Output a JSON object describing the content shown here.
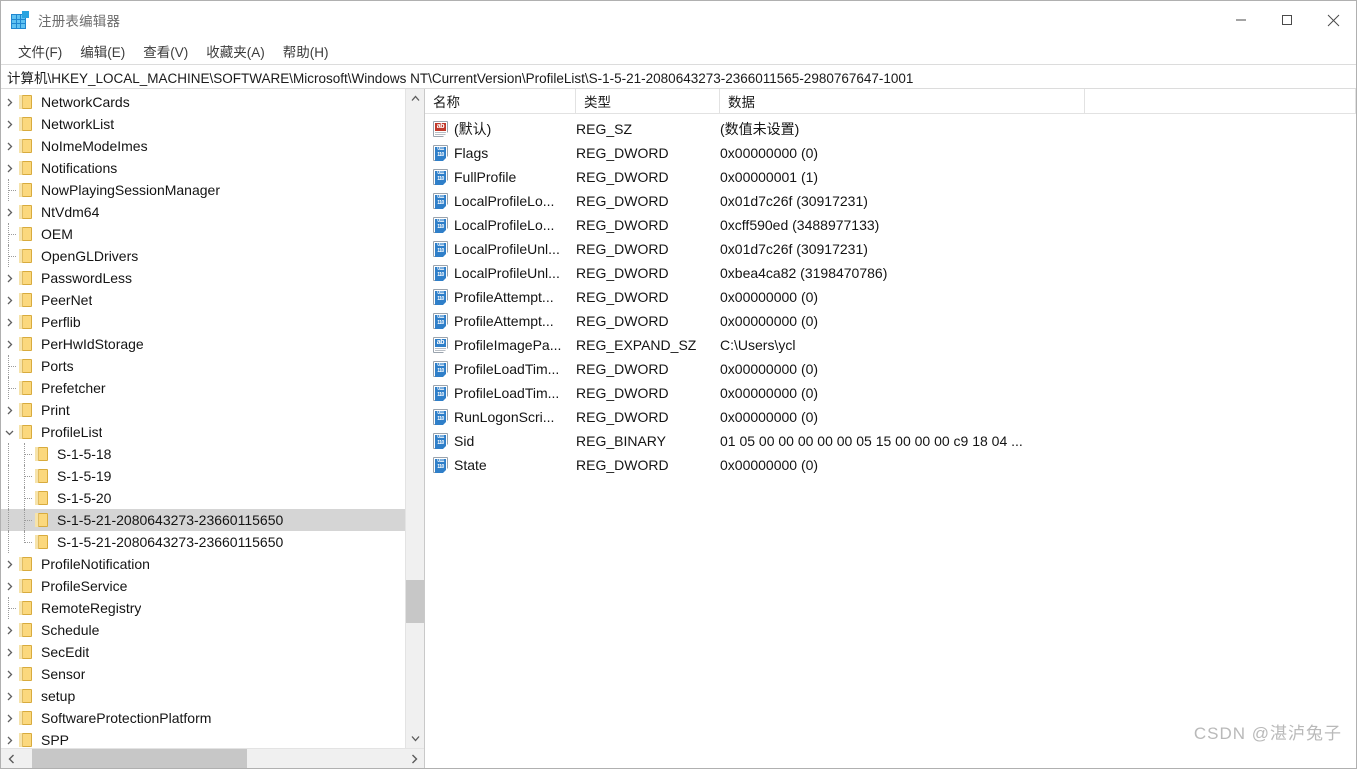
{
  "window": {
    "title": "注册表编辑器",
    "app_icon": "registry-grid-icon",
    "minimize_label": "最小化",
    "maximize_label": "最大化",
    "close_label": "关闭"
  },
  "menubar": {
    "items": [
      {
        "label": "文件(F)"
      },
      {
        "label": "编辑(E)"
      },
      {
        "label": "查看(V)"
      },
      {
        "label": "收藏夹(A)"
      },
      {
        "label": "帮助(H)"
      }
    ]
  },
  "address": {
    "path": "计算机\\HKEY_LOCAL_MACHINE\\SOFTWARE\\Microsoft\\Windows NT\\CurrentVersion\\ProfileList\\S-1-5-21-2080643273-2366011565-2980767647-1001"
  },
  "tree": {
    "items": [
      {
        "label": "NetworkCards",
        "depth": 0,
        "twisty": "collapsed",
        "selected": false
      },
      {
        "label": "NetworkList",
        "depth": 0,
        "twisty": "collapsed",
        "selected": false
      },
      {
        "label": "NoImeModeImes",
        "depth": 0,
        "twisty": "collapsed",
        "selected": false
      },
      {
        "label": "Notifications",
        "depth": 0,
        "twisty": "collapsed",
        "selected": false
      },
      {
        "label": "NowPlayingSessionManager",
        "depth": 0,
        "twisty": "leaf",
        "selected": false
      },
      {
        "label": "NtVdm64",
        "depth": 0,
        "twisty": "collapsed",
        "selected": false
      },
      {
        "label": "OEM",
        "depth": 0,
        "twisty": "leaf",
        "selected": false
      },
      {
        "label": "OpenGLDrivers",
        "depth": 0,
        "twisty": "leaf",
        "selected": false
      },
      {
        "label": "PasswordLess",
        "depth": 0,
        "twisty": "collapsed",
        "selected": false
      },
      {
        "label": "PeerNet",
        "depth": 0,
        "twisty": "collapsed",
        "selected": false
      },
      {
        "label": "Perflib",
        "depth": 0,
        "twisty": "collapsed",
        "selected": false
      },
      {
        "label": "PerHwIdStorage",
        "depth": 0,
        "twisty": "collapsed",
        "selected": false
      },
      {
        "label": "Ports",
        "depth": 0,
        "twisty": "leaf",
        "selected": false
      },
      {
        "label": "Prefetcher",
        "depth": 0,
        "twisty": "leaf",
        "selected": false
      },
      {
        "label": "Print",
        "depth": 0,
        "twisty": "collapsed",
        "selected": false
      },
      {
        "label": "ProfileList",
        "depth": 0,
        "twisty": "expanded",
        "selected": false
      },
      {
        "label": "S-1-5-18",
        "depth": 1,
        "twisty": "leaf",
        "selected": false
      },
      {
        "label": "S-1-5-19",
        "depth": 1,
        "twisty": "leaf",
        "selected": false
      },
      {
        "label": "S-1-5-20",
        "depth": 1,
        "twisty": "leaf",
        "selected": false
      },
      {
        "label": "S-1-5-21-2080643273-23660115650",
        "depth": 1,
        "twisty": "leaf",
        "selected": true
      },
      {
        "label": "S-1-5-21-2080643273-23660115650",
        "depth": 1,
        "twisty": "leaf",
        "selected": false
      },
      {
        "label": "ProfileNotification",
        "depth": 0,
        "twisty": "collapsed",
        "selected": false
      },
      {
        "label": "ProfileService",
        "depth": 0,
        "twisty": "collapsed",
        "selected": false
      },
      {
        "label": "RemoteRegistry",
        "depth": 0,
        "twisty": "leaf",
        "selected": false
      },
      {
        "label": "Schedule",
        "depth": 0,
        "twisty": "collapsed",
        "selected": false
      },
      {
        "label": "SecEdit",
        "depth": 0,
        "twisty": "collapsed",
        "selected": false
      },
      {
        "label": "Sensor",
        "depth": 0,
        "twisty": "collapsed",
        "selected": false
      },
      {
        "label": "setup",
        "depth": 0,
        "twisty": "collapsed",
        "selected": false
      },
      {
        "label": "SoftwareProtectionPlatform",
        "depth": 0,
        "twisty": "collapsed",
        "selected": false
      },
      {
        "label": "SPP",
        "depth": 0,
        "twisty": "collapsed",
        "selected": false
      }
    ],
    "vscroll": {
      "thumb_top_pct": 76,
      "thumb_height_pct": 7
    },
    "hscroll": {
      "thumb_left_pct": 3,
      "thumb_width_pct": 56
    }
  },
  "values": {
    "columns": [
      "名称",
      "类型",
      "数据"
    ],
    "rows": [
      {
        "name": "(默认)",
        "icon": "string-default-icon",
        "type": "REG_SZ",
        "data": "(数值未设置)"
      },
      {
        "name": "Flags",
        "icon": "dword-icon",
        "type": "REG_DWORD",
        "data": "0x00000000 (0)"
      },
      {
        "name": "FullProfile",
        "icon": "dword-icon",
        "type": "REG_DWORD",
        "data": "0x00000001 (1)"
      },
      {
        "name": "LocalProfileLo...",
        "icon": "dword-icon",
        "type": "REG_DWORD",
        "data": "0x01d7c26f (30917231)"
      },
      {
        "name": "LocalProfileLo...",
        "icon": "dword-icon",
        "type": "REG_DWORD",
        "data": "0xcff590ed (3488977133)"
      },
      {
        "name": "LocalProfileUnl...",
        "icon": "dword-icon",
        "type": "REG_DWORD",
        "data": "0x01d7c26f (30917231)"
      },
      {
        "name": "LocalProfileUnl...",
        "icon": "dword-icon",
        "type": "REG_DWORD",
        "data": "0xbea4ca82 (3198470786)"
      },
      {
        "name": "ProfileAttempt...",
        "icon": "dword-icon",
        "type": "REG_DWORD",
        "data": "0x00000000 (0)"
      },
      {
        "name": "ProfileAttempt...",
        "icon": "dword-icon",
        "type": "REG_DWORD",
        "data": "0x00000000 (0)"
      },
      {
        "name": "ProfileImagePa...",
        "icon": "string-icon",
        "type": "REG_EXPAND_SZ",
        "data": "C:\\Users\\ycl"
      },
      {
        "name": "ProfileLoadTim...",
        "icon": "dword-icon",
        "type": "REG_DWORD",
        "data": "0x00000000 (0)"
      },
      {
        "name": "ProfileLoadTim...",
        "icon": "dword-icon",
        "type": "REG_DWORD",
        "data": "0x00000000 (0)"
      },
      {
        "name": "RunLogonScri...",
        "icon": "dword-icon",
        "type": "REG_DWORD",
        "data": "0x00000000 (0)"
      },
      {
        "name": "Sid",
        "icon": "dword-icon",
        "type": "REG_BINARY",
        "data": "01 05 00 00 00 00 00 05 15 00 00 00 c9 18 04 ..."
      },
      {
        "name": "State",
        "icon": "dword-icon",
        "type": "REG_DWORD",
        "data": "0x00000000 (0)"
      }
    ]
  },
  "watermark": {
    "text": "CSDN @湛泸兔子"
  },
  "colors": {
    "selection": "#d5d5d5",
    "folder": "#fbd87d",
    "accent": "#2f7fc9",
    "string_default": "#c0392b"
  }
}
